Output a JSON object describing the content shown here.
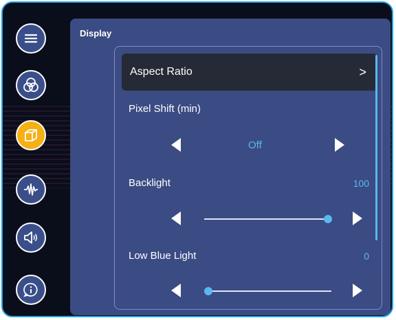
{
  "panel": {
    "title": "Display"
  },
  "sidebar": {
    "items": [
      {
        "name": "menu",
        "icon": "hamburger-menu-icon",
        "active": false
      },
      {
        "name": "color",
        "icon": "color-circles-icon",
        "active": false
      },
      {
        "name": "display",
        "icon": "display-box-icon",
        "active": true
      },
      {
        "name": "signal",
        "icon": "waveform-icon",
        "active": false
      },
      {
        "name": "audio",
        "icon": "speaker-icon",
        "active": false
      },
      {
        "name": "info",
        "icon": "info-icon",
        "active": false
      }
    ]
  },
  "settings": {
    "aspect_ratio": {
      "label": "Aspect Ratio",
      "chevron": ">"
    },
    "pixel_shift": {
      "label": "Pixel Shift (min)",
      "value": "Off"
    },
    "backlight": {
      "label": "Backlight",
      "value": "100",
      "level": 1.0
    },
    "low_blue_light": {
      "label": "Low Blue Light",
      "value": "0",
      "level": 0.0
    }
  },
  "colors": {
    "accent": "#5ab8f0",
    "active_icon": "#f5b014",
    "panel": "#3b4b83",
    "frame": "#1fa3e8"
  }
}
